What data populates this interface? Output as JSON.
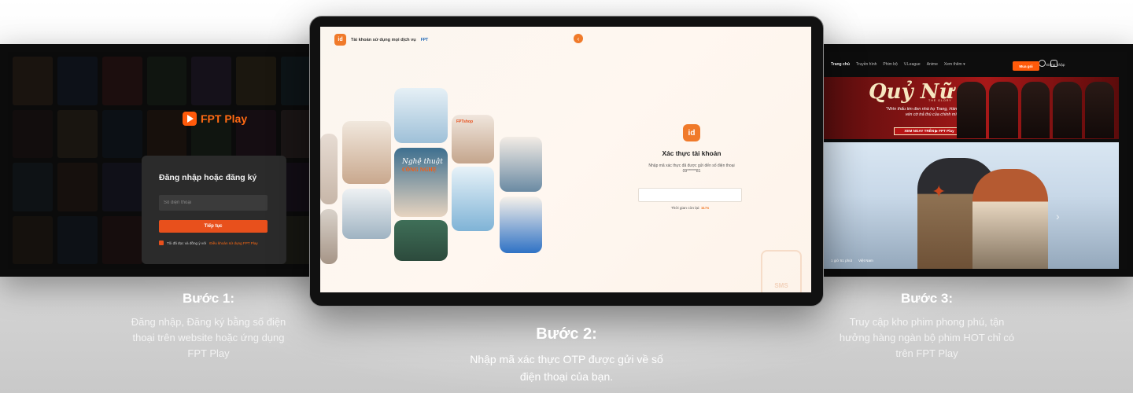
{
  "step1": {
    "brand": "FPT Play",
    "login_title": "Đăng nhập hoặc đăng ký",
    "phone_placeholder": "Số điện thoại",
    "continue_label": "Tiếp tục",
    "terms_prefix": "Tôi đã đọc và đồng ý với",
    "terms_link": "Điều khoản sử dụng FPT Play",
    "caption_title": "Bước 1:",
    "caption_line1": "Đăng nhập, Đăng ký bằng số điện",
    "caption_line2": "thoại trên website hoặc ứng dụng",
    "caption_line3": "FPT Play"
  },
  "step2": {
    "logo_badge": "id",
    "logo_text": "Tài khoản sử dụng mọi dịch vụ",
    "logo_fpt": "FPT",
    "tile_brand": "FPTshop",
    "tile_script1": "Nghệ thuật",
    "tile_script2": "CÔNG NGHỆ",
    "verify_title": "Xác thực tài khoản",
    "verify_desc": "Nhập mã xác thực đã được gửi đến số điện thoại",
    "masked_phone": "09******81",
    "timer_label": "Thời gian còn lại:",
    "timer_value": "117s",
    "sms_text": "SMS",
    "caption_title": "Bước 2:",
    "caption_line1": "Nhập mã xác thực OTP được gửi về số",
    "caption_line2": "điện thoại của bạn."
  },
  "step3": {
    "nav_items": [
      "Trang chủ",
      "Truyền hình",
      "Phim bộ",
      "V.League",
      "Anime",
      "Xem thêm ▾"
    ],
    "buy_label": "Mua gói",
    "login_label": "Đăng nhập",
    "banner_title": "Quỷ Nữ",
    "banner_sub": "THE GLORY",
    "banner_quote": "\"Nhìn thấu tim đen nhà họ Trang, Hàn Nhan bắt đầu vén cờ trả thù của chính mình!\"",
    "banner_cta": "XEM NGAY TRÊN ▶ FPT Play",
    "hero_duration": "1 giờ 51 phút",
    "hero_country": "Việt Nam",
    "caption_title": "Bước 3:",
    "caption_line1": "Truy cập kho phim phong phú, tận",
    "caption_line2": "hưởng hàng ngàn bộ phim HOT chỉ có",
    "caption_line3": "trên FPT Play"
  },
  "colors": {
    "accent": "#ff5a0a",
    "otp_badge": "#f07a2a",
    "card_bg": "#2b2b2b"
  }
}
